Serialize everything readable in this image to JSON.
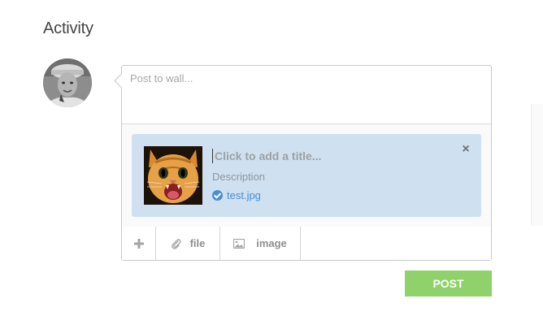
{
  "page": {
    "heading": "Activity"
  },
  "composer": {
    "placeholder": "Post to wall...",
    "value": "",
    "attachment": {
      "title_placeholder": "Click to add a title...",
      "description_placeholder": "Description",
      "file_name": "test.jpg",
      "thumbnail_icon": "kitten-image",
      "remove_symbol": "×"
    },
    "toolbar": {
      "items": [
        {
          "label": "",
          "icon": "plus-icon"
        },
        {
          "label": "file",
          "icon": "paperclip-icon"
        },
        {
          "label": "image",
          "icon": "image-icon"
        }
      ]
    },
    "post_label": "POST"
  },
  "colors": {
    "attachment_bg": "#cfe0f0",
    "link_blue": "#4a8fd2",
    "post_button": "#8fd16a"
  }
}
